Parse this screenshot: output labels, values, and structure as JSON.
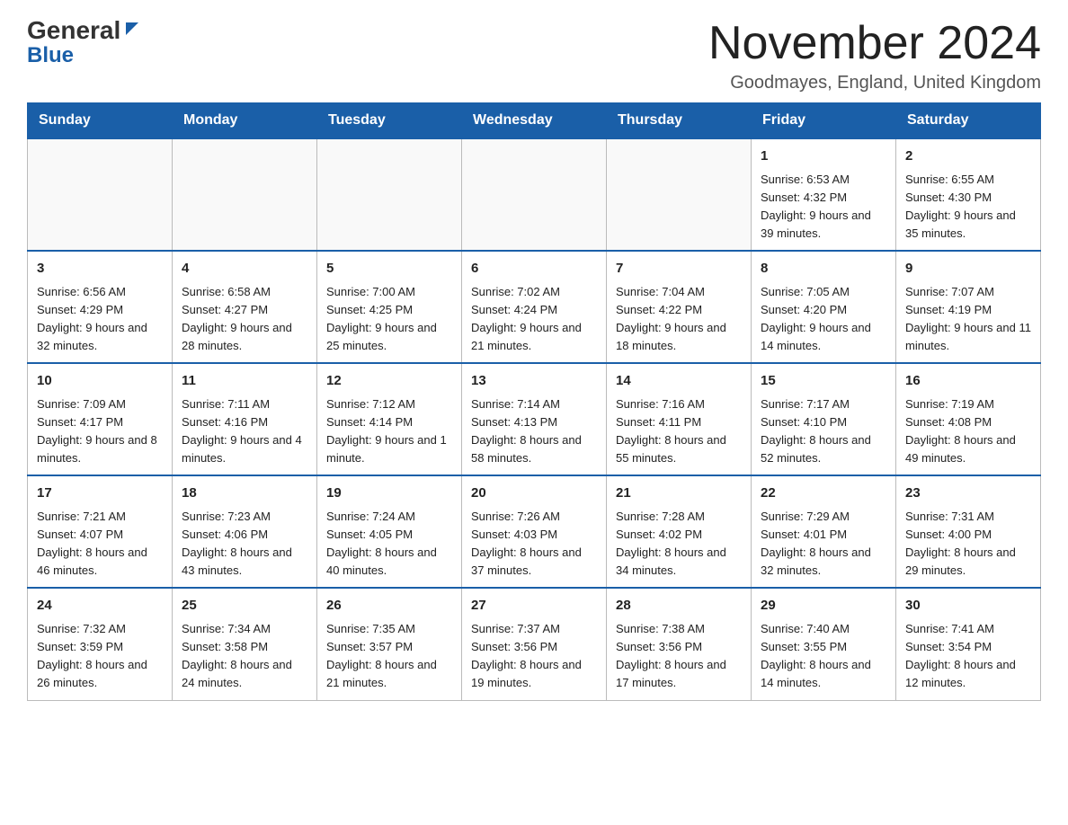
{
  "header": {
    "logo_general": "General",
    "logo_blue": "Blue",
    "month_title": "November 2024",
    "location": "Goodmayes, England, United Kingdom"
  },
  "days_of_week": [
    "Sunday",
    "Monday",
    "Tuesday",
    "Wednesday",
    "Thursday",
    "Friday",
    "Saturday"
  ],
  "weeks": [
    [
      {
        "day": "",
        "info": ""
      },
      {
        "day": "",
        "info": ""
      },
      {
        "day": "",
        "info": ""
      },
      {
        "day": "",
        "info": ""
      },
      {
        "day": "",
        "info": ""
      },
      {
        "day": "1",
        "info": "Sunrise: 6:53 AM\nSunset: 4:32 PM\nDaylight: 9 hours and 39 minutes."
      },
      {
        "day": "2",
        "info": "Sunrise: 6:55 AM\nSunset: 4:30 PM\nDaylight: 9 hours and 35 minutes."
      }
    ],
    [
      {
        "day": "3",
        "info": "Sunrise: 6:56 AM\nSunset: 4:29 PM\nDaylight: 9 hours and 32 minutes."
      },
      {
        "day": "4",
        "info": "Sunrise: 6:58 AM\nSunset: 4:27 PM\nDaylight: 9 hours and 28 minutes."
      },
      {
        "day": "5",
        "info": "Sunrise: 7:00 AM\nSunset: 4:25 PM\nDaylight: 9 hours and 25 minutes."
      },
      {
        "day": "6",
        "info": "Sunrise: 7:02 AM\nSunset: 4:24 PM\nDaylight: 9 hours and 21 minutes."
      },
      {
        "day": "7",
        "info": "Sunrise: 7:04 AM\nSunset: 4:22 PM\nDaylight: 9 hours and 18 minutes."
      },
      {
        "day": "8",
        "info": "Sunrise: 7:05 AM\nSunset: 4:20 PM\nDaylight: 9 hours and 14 minutes."
      },
      {
        "day": "9",
        "info": "Sunrise: 7:07 AM\nSunset: 4:19 PM\nDaylight: 9 hours and 11 minutes."
      }
    ],
    [
      {
        "day": "10",
        "info": "Sunrise: 7:09 AM\nSunset: 4:17 PM\nDaylight: 9 hours and 8 minutes."
      },
      {
        "day": "11",
        "info": "Sunrise: 7:11 AM\nSunset: 4:16 PM\nDaylight: 9 hours and 4 minutes."
      },
      {
        "day": "12",
        "info": "Sunrise: 7:12 AM\nSunset: 4:14 PM\nDaylight: 9 hours and 1 minute."
      },
      {
        "day": "13",
        "info": "Sunrise: 7:14 AM\nSunset: 4:13 PM\nDaylight: 8 hours and 58 minutes."
      },
      {
        "day": "14",
        "info": "Sunrise: 7:16 AM\nSunset: 4:11 PM\nDaylight: 8 hours and 55 minutes."
      },
      {
        "day": "15",
        "info": "Sunrise: 7:17 AM\nSunset: 4:10 PM\nDaylight: 8 hours and 52 minutes."
      },
      {
        "day": "16",
        "info": "Sunrise: 7:19 AM\nSunset: 4:08 PM\nDaylight: 8 hours and 49 minutes."
      }
    ],
    [
      {
        "day": "17",
        "info": "Sunrise: 7:21 AM\nSunset: 4:07 PM\nDaylight: 8 hours and 46 minutes."
      },
      {
        "day": "18",
        "info": "Sunrise: 7:23 AM\nSunset: 4:06 PM\nDaylight: 8 hours and 43 minutes."
      },
      {
        "day": "19",
        "info": "Sunrise: 7:24 AM\nSunset: 4:05 PM\nDaylight: 8 hours and 40 minutes."
      },
      {
        "day": "20",
        "info": "Sunrise: 7:26 AM\nSunset: 4:03 PM\nDaylight: 8 hours and 37 minutes."
      },
      {
        "day": "21",
        "info": "Sunrise: 7:28 AM\nSunset: 4:02 PM\nDaylight: 8 hours and 34 minutes."
      },
      {
        "day": "22",
        "info": "Sunrise: 7:29 AM\nSunset: 4:01 PM\nDaylight: 8 hours and 32 minutes."
      },
      {
        "day": "23",
        "info": "Sunrise: 7:31 AM\nSunset: 4:00 PM\nDaylight: 8 hours and 29 minutes."
      }
    ],
    [
      {
        "day": "24",
        "info": "Sunrise: 7:32 AM\nSunset: 3:59 PM\nDaylight: 8 hours and 26 minutes."
      },
      {
        "day": "25",
        "info": "Sunrise: 7:34 AM\nSunset: 3:58 PM\nDaylight: 8 hours and 24 minutes."
      },
      {
        "day": "26",
        "info": "Sunrise: 7:35 AM\nSunset: 3:57 PM\nDaylight: 8 hours and 21 minutes."
      },
      {
        "day": "27",
        "info": "Sunrise: 7:37 AM\nSunset: 3:56 PM\nDaylight: 8 hours and 19 minutes."
      },
      {
        "day": "28",
        "info": "Sunrise: 7:38 AM\nSunset: 3:56 PM\nDaylight: 8 hours and 17 minutes."
      },
      {
        "day": "29",
        "info": "Sunrise: 7:40 AM\nSunset: 3:55 PM\nDaylight: 8 hours and 14 minutes."
      },
      {
        "day": "30",
        "info": "Sunrise: 7:41 AM\nSunset: 3:54 PM\nDaylight: 8 hours and 12 minutes."
      }
    ]
  ]
}
